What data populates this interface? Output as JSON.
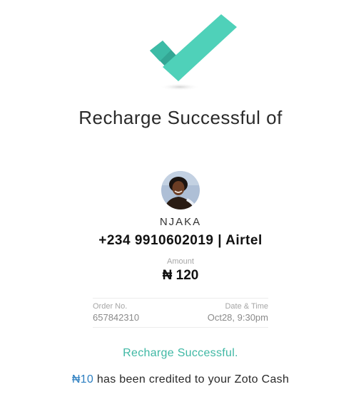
{
  "icons": {
    "success": "checkmark-icon"
  },
  "colors": {
    "check_main": "#4fd1b9",
    "check_dark": "#33a694",
    "status_text": "#3fb8a4",
    "credit_amount": "#2d7fc1"
  },
  "header": {
    "title": "Recharge Successful of"
  },
  "recipient": {
    "name": "NJAKA",
    "phone_operator": "+234 9910602019 | Airtel"
  },
  "amount": {
    "label": "Amount",
    "value": "₦ 120"
  },
  "details": {
    "order_label": "Order No.",
    "order_value": "657842310",
    "datetime_label": "Date & Time",
    "datetime_value": "Oct28, 9:30pm"
  },
  "status": {
    "message": "Recharge Successful."
  },
  "credit": {
    "amount": "₦10",
    "text": " has been credited to your Zoto Cash"
  }
}
